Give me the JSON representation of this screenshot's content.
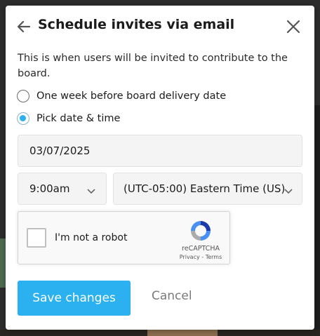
{
  "modal": {
    "title": "Schedule invites via email",
    "description": "This is when users will be invited to contribute to the board."
  },
  "options": [
    {
      "label": "One week before board delivery date",
      "selected": false
    },
    {
      "label": "Pick date & time",
      "selected": true
    }
  ],
  "date": {
    "value": "03/07/2025"
  },
  "time": {
    "value": "9:00am"
  },
  "timezone": {
    "value": "(UTC-05:00) Eastern Time (US)"
  },
  "recaptcha": {
    "label": "I'm not a robot",
    "brand": "reCAPTCHA",
    "links": "Privacy - Terms"
  },
  "actions": {
    "save": "Save changes",
    "cancel": "Cancel"
  },
  "colors": {
    "accent": "#2bb1f0",
    "cancel_text": "#7a7a7a"
  },
  "icons": [
    "back-arrow-icon",
    "close-icon",
    "chevron-down-icon",
    "recaptcha-logo-icon"
  ]
}
